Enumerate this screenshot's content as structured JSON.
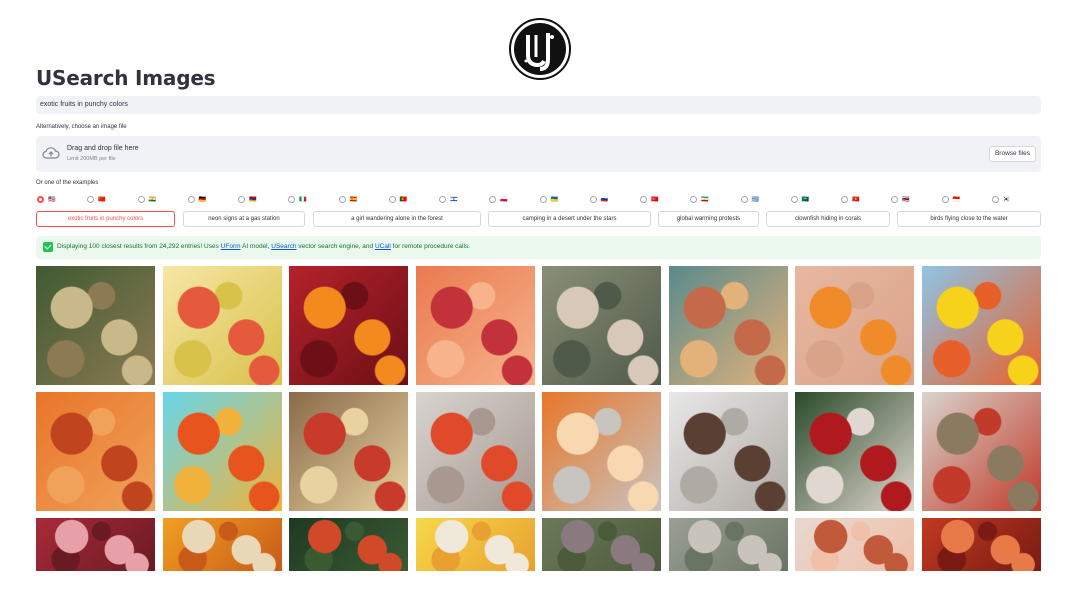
{
  "app": {
    "logo_icon": "usearch-logo-icon",
    "title": "USearch Images"
  },
  "search": {
    "value": "exotic fruits in punchy colors"
  },
  "upload": {
    "label": "Alternatively, choose an image file",
    "drop_text": "Drag and drop file here",
    "limit_text": "Limit 200MB per file",
    "browse_label": "Browse files",
    "icon": "cloud-upload-icon"
  },
  "examples": {
    "label": "Or one of the examples",
    "languages": [
      {
        "flag": "🇺🇸",
        "selected": true
      },
      {
        "flag": "🇨🇳",
        "selected": false
      },
      {
        "flag": "🇮🇳",
        "selected": false
      },
      {
        "flag": "🇩🇪",
        "selected": false
      },
      {
        "flag": "🇦🇲",
        "selected": false
      },
      {
        "flag": "🇮🇹",
        "selected": false
      },
      {
        "flag": "🇪🇸",
        "selected": false
      },
      {
        "flag": "🇵🇹",
        "selected": false
      },
      {
        "flag": "🇮🇱",
        "selected": false
      },
      {
        "flag": "🇵🇱",
        "selected": false
      },
      {
        "flag": "🇺🇦",
        "selected": false
      },
      {
        "flag": "🇷🇺",
        "selected": false
      },
      {
        "flag": "🇹🇷",
        "selected": false
      },
      {
        "flag": "🇮🇷",
        "selected": false
      },
      {
        "flag": "🇬🇷",
        "selected": false
      },
      {
        "flag": "🇸🇦",
        "selected": false
      },
      {
        "flag": "🇻🇳",
        "selected": false
      },
      {
        "flag": "🇹🇭",
        "selected": false
      },
      {
        "flag": "🇮🇩",
        "selected": false
      },
      {
        "flag": "🇰🇷",
        "selected": false
      }
    ],
    "queries": [
      "exotic fruits in punchy colors",
      "neon signs at a gas station",
      "a girl wandering alone in the forest",
      "camping in a desert under the stars",
      "global warming protests",
      "clownfish hiding in corals",
      "birds flying close to the water"
    ],
    "active_index": 0
  },
  "status": {
    "text_before": "Displaying 100 closest results from 24,292 entries! Uses ",
    "link_uform": "UForm",
    "text_mid1": " AI model, ",
    "link_usearch": "USearch",
    "text_mid2": " vector search engine, and ",
    "link_ucall": "UCall",
    "text_after": " for remote procedure calls."
  },
  "results": [
    {
      "name": "result-image-passion-fruits",
      "colors": [
        "#3f5a32",
        "#c9b98a",
        "#8c7a52"
      ]
    },
    {
      "name": "result-image-sliced-fruits-flatlay",
      "colors": [
        "#f7e6a6",
        "#e55a3c",
        "#d8c24a"
      ]
    },
    {
      "name": "result-image-oranges-pomegranates",
      "colors": [
        "#b5222a",
        "#f28a1e",
        "#6d0f16"
      ]
    },
    {
      "name": "result-image-grapefruits-kiwi",
      "colors": [
        "#ea7a4f",
        "#c3323a",
        "#f6b38c"
      ]
    },
    {
      "name": "result-image-cactus",
      "colors": [
        "#8a8f76",
        "#d8c8b8",
        "#4f5a4a"
      ]
    },
    {
      "name": "result-image-pineapples",
      "colors": [
        "#5a8a8c",
        "#c46a4a",
        "#e3b27a"
      ]
    },
    {
      "name": "result-image-orange-bowl",
      "colors": [
        "#e8b7a0",
        "#f08b2a",
        "#d9a38a"
      ]
    },
    {
      "name": "result-image-orange-on-yellow",
      "colors": [
        "#8fc4e6",
        "#f7d21a",
        "#e7602a"
      ]
    },
    {
      "name": "result-image-peaches",
      "colors": [
        "#e8752a",
        "#c0441e",
        "#f0a25a"
      ]
    },
    {
      "name": "result-image-apple-blue",
      "colors": [
        "#67d6ea",
        "#e8541e",
        "#f0b23a"
      ]
    },
    {
      "name": "result-image-berries-wood",
      "colors": [
        "#8a6a4a",
        "#c83a2a",
        "#e8d2a0"
      ]
    },
    {
      "name": "result-image-red-berries-branch",
      "colors": [
        "#d8d4d0",
        "#e04a2a",
        "#a89890"
      ]
    },
    {
      "name": "result-image-persimmon-halves",
      "colors": [
        "#e8762a",
        "#f7d8b0",
        "#c8c4c0"
      ]
    },
    {
      "name": "result-image-bare-branches",
      "colors": [
        "#e8e8e8",
        "#5a4032",
        "#b0aaa4"
      ]
    },
    {
      "name": "result-image-christmas-ornaments",
      "colors": [
        "#2a4a2a",
        "#b01a1e",
        "#e0d8d0"
      ]
    },
    {
      "name": "result-image-dry-field",
      "colors": [
        "#d8d4cc",
        "#8a7a60",
        "#c23a2a"
      ]
    },
    {
      "name": "result-image-berries-close",
      "colors": [
        "#a82a3a",
        "#e8a0a8",
        "#6a1a22"
      ]
    },
    {
      "name": "result-image-orange-jar",
      "colors": [
        "#f0a020",
        "#e8d8b8",
        "#c85a1a"
      ]
    },
    {
      "name": "result-image-dark-leaves",
      "colors": [
        "#1e3a22",
        "#d04a2a",
        "#3a5a32"
      ]
    },
    {
      "name": "result-image-yellow-snacks",
      "colors": [
        "#f7d84a",
        "#f0e8d8",
        "#e8a030"
      ]
    },
    {
      "name": "result-image-grapes",
      "colors": [
        "#6a7a5a",
        "#8a7a80",
        "#4a5a3a"
      ]
    },
    {
      "name": "result-image-succulent",
      "colors": [
        "#9aa094",
        "#c8c4bc",
        "#6a7464"
      ]
    },
    {
      "name": "result-image-sea-urchins",
      "colors": [
        "#e8d8d0",
        "#c05a3a",
        "#f0c0a8"
      ]
    },
    {
      "name": "result-image-red-fruits-pile",
      "colors": [
        "#c03a22",
        "#e87a4a",
        "#7a1a12"
      ]
    }
  ]
}
